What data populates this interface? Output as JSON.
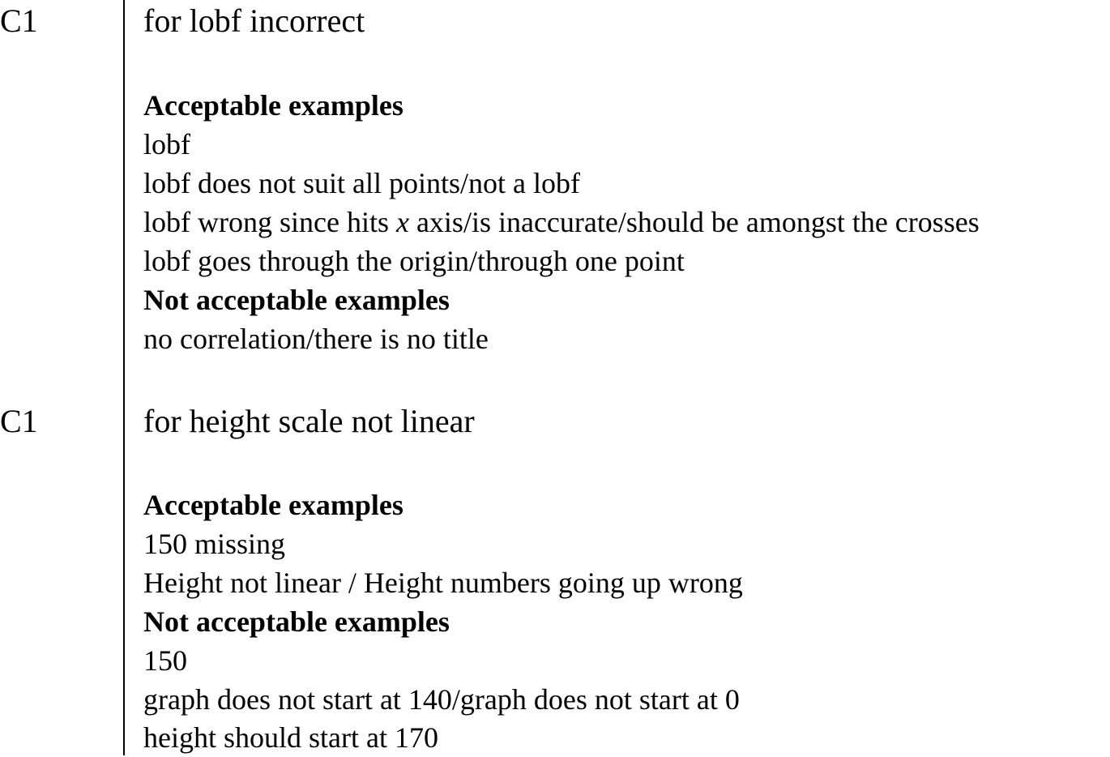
{
  "criteria": [
    {
      "mark": "C1",
      "heading": "for lobf incorrect",
      "acceptable_label": "Acceptable examples",
      "acceptable": [
        "lobf",
        "lobf does not suit all points/not a lobf",
        "lobf goes through the origin/through one point"
      ],
      "acceptable_italic_line": {
        "before": "lobf wrong since hits ",
        "italic": "x",
        "after": " axis/is inaccurate/should be amongst the crosses"
      },
      "not_acceptable_label": "Not acceptable examples",
      "not_acceptable": [
        "no correlation/there is no title"
      ]
    },
    {
      "mark": "C1",
      "heading": "for height scale not linear",
      "acceptable_label": "Acceptable examples",
      "acceptable": [
        "150 missing",
        "Height not linear / Height numbers going up wrong"
      ],
      "not_acceptable_label": "Not acceptable examples",
      "not_acceptable": [
        "150",
        "graph does not start at 140/graph does not start at 0",
        "height should start at 170"
      ]
    }
  ]
}
